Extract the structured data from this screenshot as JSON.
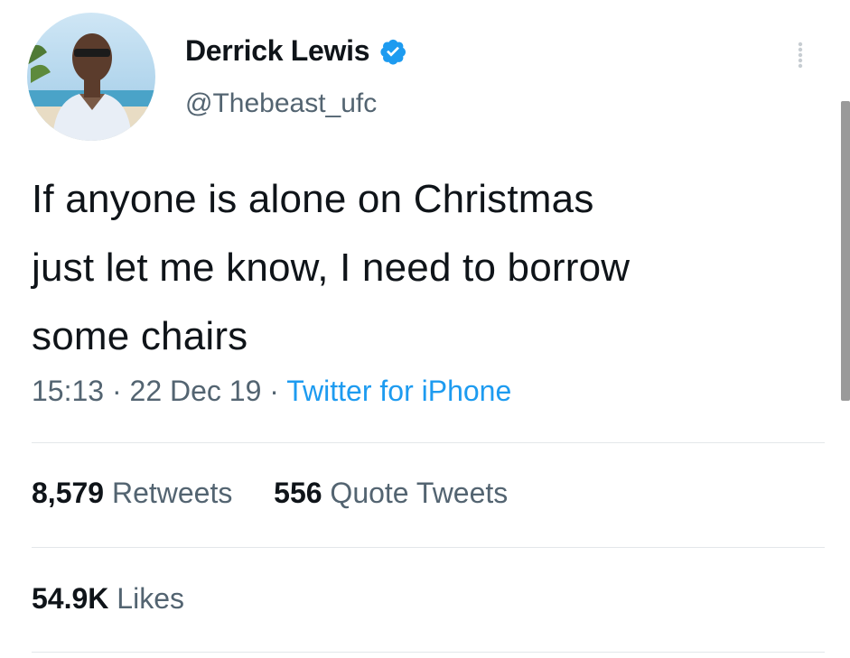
{
  "author": {
    "display_name": "Derrick Lewis",
    "handle": "@Thebeast_ufc",
    "verified": true,
    "verified_color": "#1d9bf0"
  },
  "tweet": {
    "text": "If anyone is alone on Christmas\njust let me know, I need to borrow\nsome chairs",
    "time": "15:13",
    "date": "22 Dec 19",
    "separator": "·",
    "source": "Twitter for iPhone"
  },
  "stats": {
    "retweets_count": "8,579",
    "retweets_label": "Retweets",
    "quote_count": "556",
    "quote_label": "Quote Tweets",
    "likes_count": "54.9K",
    "likes_label": "Likes"
  },
  "icons": {
    "more": "more-vertical-icon",
    "verified": "verified-badge-icon"
  },
  "colors": {
    "text_primary": "#0f1419",
    "text_secondary": "#536471",
    "link": "#1d9bf0",
    "divider": "#e3e7ea"
  }
}
